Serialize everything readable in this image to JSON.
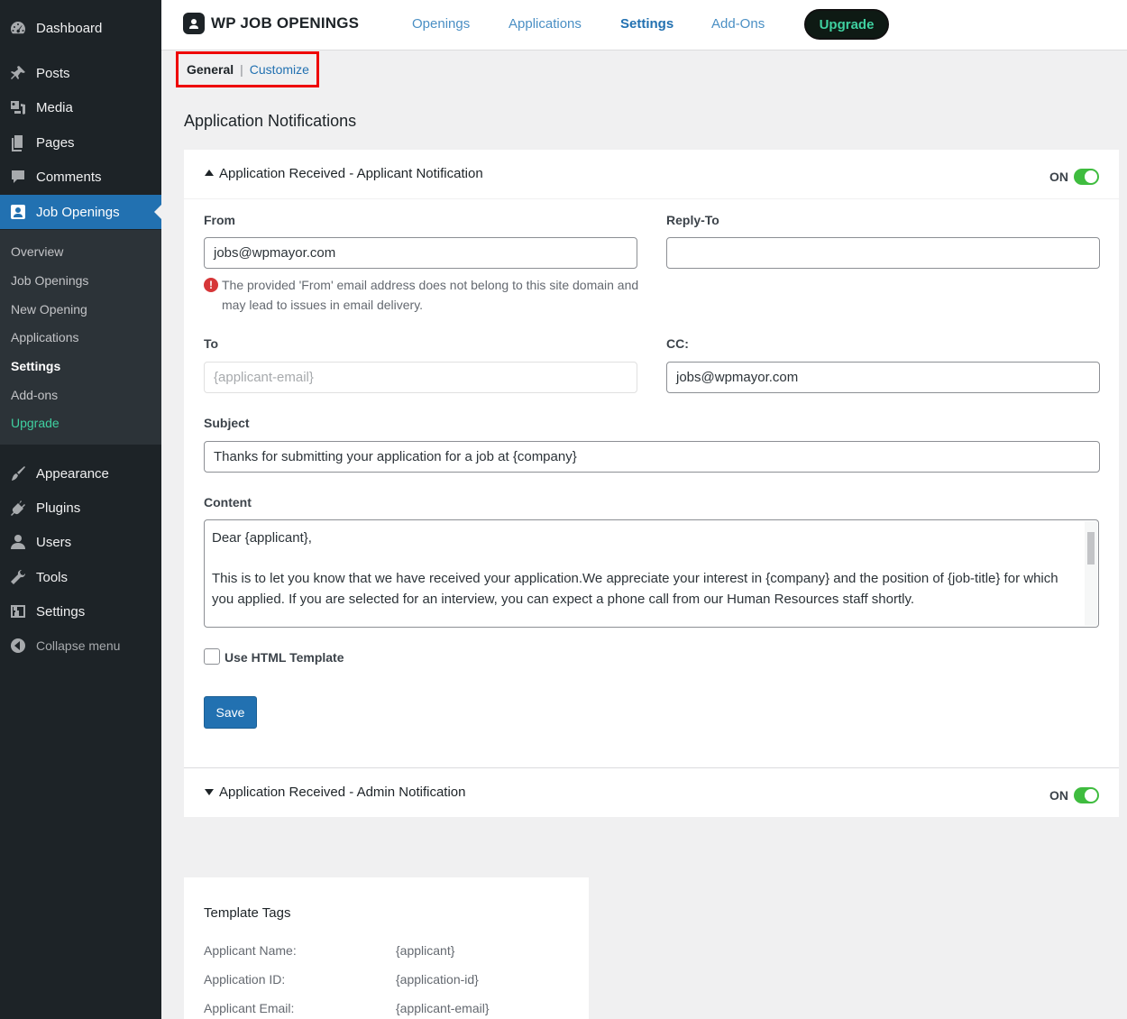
{
  "sidebar": {
    "items": [
      {
        "label": "Dashboard",
        "icon": "dashboard-icon"
      },
      {
        "label": "Posts",
        "icon": "pin-icon"
      },
      {
        "label": "Media",
        "icon": "media-icon"
      },
      {
        "label": "Pages",
        "icon": "pages-icon"
      },
      {
        "label": "Comments",
        "icon": "comment-icon"
      },
      {
        "label": "Job Openings",
        "icon": "job-openings-icon"
      },
      {
        "label": "Appearance",
        "icon": "brush-icon"
      },
      {
        "label": "Plugins",
        "icon": "plug-icon"
      },
      {
        "label": "Users",
        "icon": "user-icon"
      },
      {
        "label": "Tools",
        "icon": "wrench-icon"
      },
      {
        "label": "Settings",
        "icon": "settings-icon"
      },
      {
        "label": "Collapse menu",
        "icon": "collapse-icon"
      }
    ],
    "submenu": [
      "Overview",
      "Job Openings",
      "New Opening",
      "Applications",
      "Settings",
      "Add-ons",
      "Upgrade"
    ],
    "current_submenu": "Settings"
  },
  "topbar": {
    "brand": "WP JOB OPENINGS",
    "nav": [
      "Openings",
      "Applications",
      "Settings",
      "Add-Ons"
    ],
    "active": "Settings",
    "upgrade": "Upgrade"
  },
  "subtabs": {
    "general": "General",
    "separator": "|",
    "customize": "Customize"
  },
  "page_title": "Application Notifications",
  "notification1": {
    "title": "Application Received - Applicant Notification",
    "toggle": "ON",
    "from_label": "From",
    "from_value": "jobs@wpmayor.com",
    "warning": "The provided 'From' email address does not belong to this site domain and may lead to issues in email delivery.",
    "warning_icon": "!",
    "reply_label": "Reply-To",
    "reply_value": "",
    "to_label": "To",
    "to_value": "{applicant-email}",
    "cc_label": "CC:",
    "cc_value": "jobs@wpmayor.com",
    "subject_label": "Subject",
    "subject_value": "Thanks for submitting your application for a job at {company}",
    "content_label": "Content",
    "content_line1": "Dear {applicant},",
    "content_line2": "This is to let you know that we have received your application.We appreciate your interest in {company} and the position of {job-title} for which you applied.  If you are selected for an interview, you can expect a phone call from our Human Resources staff shortly.",
    "html_template_label": "Use HTML Template",
    "save": "Save"
  },
  "notification2": {
    "title": "Application Received - Admin Notification",
    "toggle": "ON"
  },
  "template_tags": {
    "title": "Template Tags",
    "rows": [
      {
        "k": "Applicant Name:",
        "v": "{applicant}"
      },
      {
        "k": "Application ID:",
        "v": "{application-id}"
      },
      {
        "k": "Applicant Email:",
        "v": "{applicant-email}"
      }
    ]
  }
}
